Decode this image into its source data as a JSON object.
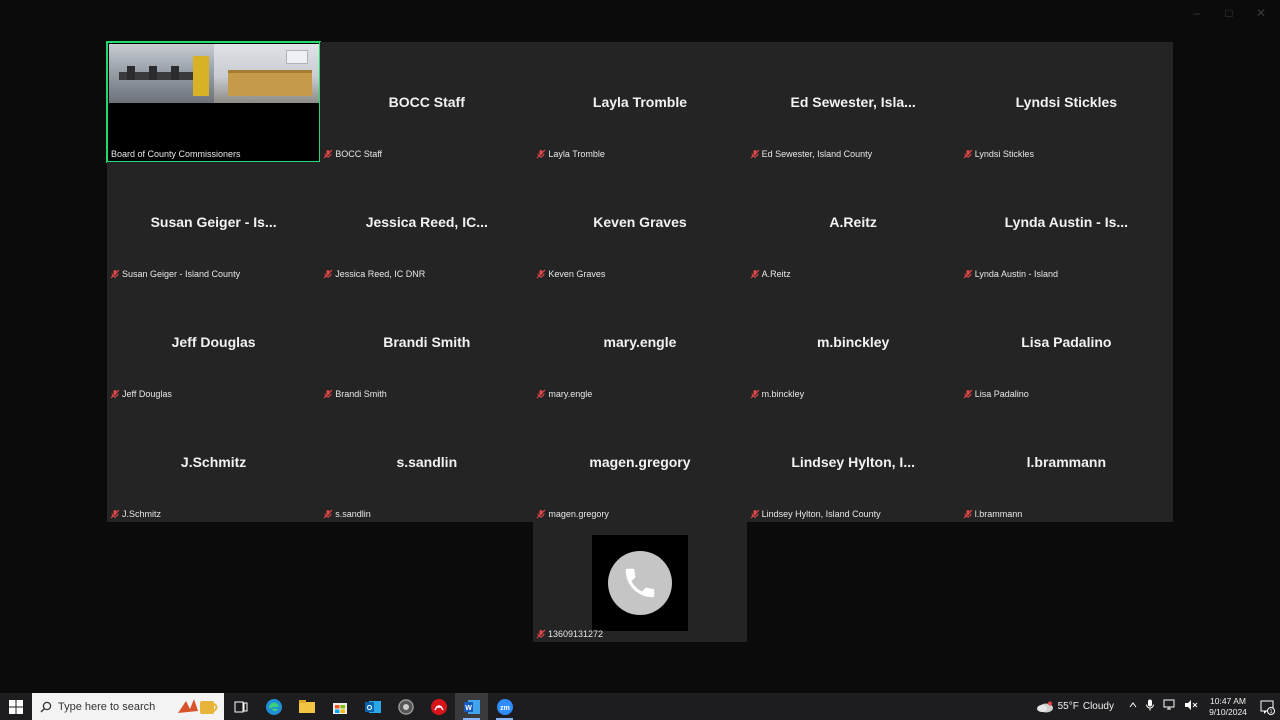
{
  "gallery": {
    "video_tile": {
      "label": "Board of County Commissioners"
    },
    "participants": [
      {
        "display": "BOCC Staff",
        "label": "BOCC Staff"
      },
      {
        "display": "Layla Tromble",
        "label": "Layla Tromble"
      },
      {
        "display": "Ed Sewester, Isla...",
        "label": "Ed Sewester, Island County"
      },
      {
        "display": "Lyndsi Stickles",
        "label": "Lyndsi Stickles"
      },
      {
        "display": "Susan Geiger - Is...",
        "label": "Susan Geiger - Island County"
      },
      {
        "display": "Jessica Reed, IC...",
        "label": "Jessica Reed, IC DNR"
      },
      {
        "display": "Keven Graves",
        "label": "Keven Graves"
      },
      {
        "display": "A.Reitz",
        "label": "A.Reitz"
      },
      {
        "display": "Lynda Austin - Is...",
        "label": "Lynda Austin - Island"
      },
      {
        "display": "Jeff Douglas",
        "label": "Jeff Douglas"
      },
      {
        "display": "Brandi Smith",
        "label": "Brandi Smith"
      },
      {
        "display": "mary.engle",
        "label": "mary.engle"
      },
      {
        "display": "m.binckley",
        "label": "m.binckley"
      },
      {
        "display": "Lisa Padalino",
        "label": "Lisa Padalino"
      },
      {
        "display": "J.Schmitz",
        "label": "J.Schmitz"
      },
      {
        "display": "s.sandlin",
        "label": "s.sandlin"
      },
      {
        "display": "magen.gregory",
        "label": "magen.gregory"
      },
      {
        "display": "Lindsey Hylton, I...",
        "label": "Lindsey Hylton, Island County"
      },
      {
        "display": "l.brammann",
        "label": "l.brammann"
      }
    ],
    "phone_tile": {
      "label": "13609131272",
      "icon": "phone-icon"
    }
  },
  "taskbar": {
    "search_placeholder": "Type here to search",
    "apps": [
      "task-view-icon",
      "edge-icon",
      "file-explorer-icon",
      "store-icon",
      "outlook-icon",
      "chrome-icon",
      "acrobat-icon",
      "word-icon",
      "zoom-icon"
    ],
    "weather": {
      "temp": "55°F",
      "condition": "Cloudy"
    },
    "clock": {
      "time": "10:47 AM",
      "date": "9/10/2024"
    },
    "notification_count": "1"
  },
  "colors": {
    "active_speaker": "#23d96e",
    "tile_bg": "#242424",
    "muted_red": "#e0474c"
  }
}
